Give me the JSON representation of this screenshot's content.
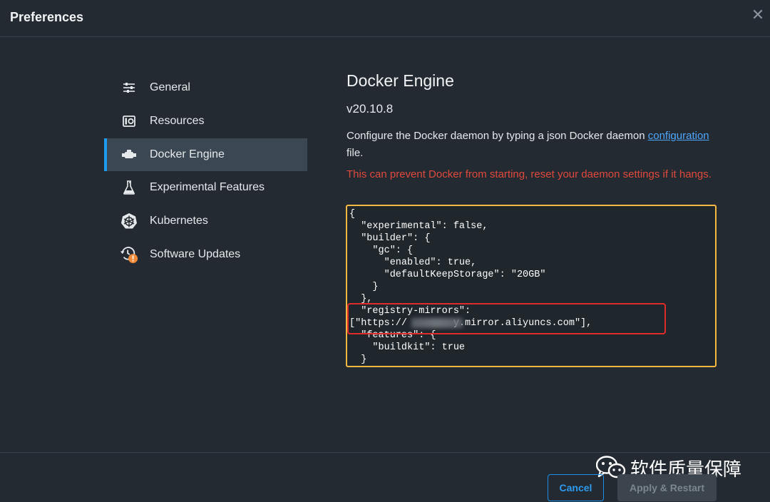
{
  "window": {
    "title": "Preferences",
    "close_icon": "close-icon"
  },
  "sidebar": {
    "items": [
      {
        "label": "General",
        "icon": "sliders-icon",
        "active": false
      },
      {
        "label": "Resources",
        "icon": "resources-icon",
        "active": false
      },
      {
        "label": "Docker Engine",
        "icon": "engine-icon",
        "active": true
      },
      {
        "label": "Experimental Features",
        "icon": "flask-icon",
        "active": false
      },
      {
        "label": "Kubernetes",
        "icon": "helm-wheel-icon",
        "active": false
      },
      {
        "label": "Software Updates",
        "icon": "update-clock-icon",
        "badge": "!",
        "active": false
      }
    ]
  },
  "main": {
    "title": "Docker Engine",
    "version": "v20.10.8",
    "description_before": "Configure the Docker daemon by typing a json Docker daemon ",
    "description_link": "configuration",
    "description_after": " file.",
    "warning": "This can prevent Docker from starting, reset your daemon settings if it hangs.",
    "config_text": "{\n  \"experimental\": false,\n  \"builder\": {\n    \"gc\": {\n      \"enabled\": true,\n      \"defaultKeepStorage\": \"20GB\"\n    }\n  },\n  \"registry-mirrors\":\n[\"https://        y.mirror.aliyuncs.com\"],\n  \"features\": {\n    \"buildkit\": true\n  }"
  },
  "footer": {
    "cancel_label": "Cancel",
    "apply_label": "Apply & Restart"
  },
  "watermark": {
    "text": "软件质量保障"
  },
  "colors": {
    "accent": "#1d9bf0",
    "warning": "#e0493c",
    "editor_border": "#f5b942",
    "highlight_box": "#e02b2b"
  }
}
